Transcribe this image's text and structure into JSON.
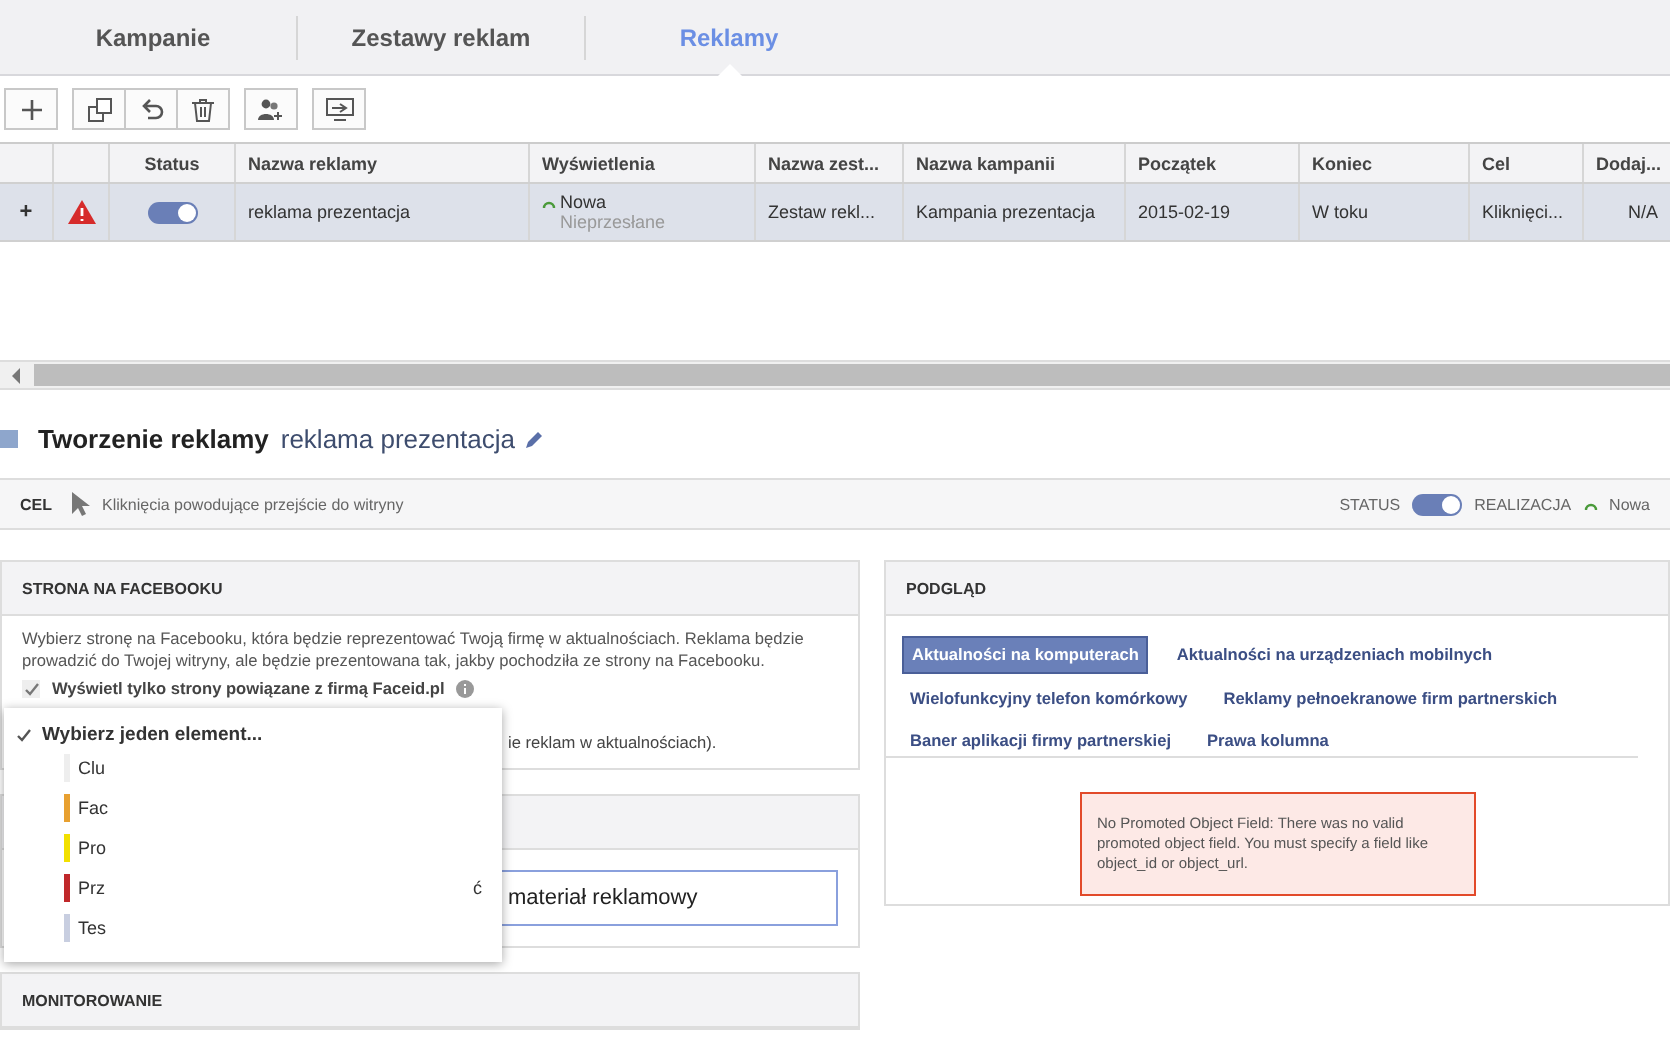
{
  "tabs": [
    {
      "label": "Kampanie",
      "selected": false
    },
    {
      "label": "Zestawy reklam",
      "selected": false
    },
    {
      "label": "Reklamy",
      "selected": true
    }
  ],
  "table": {
    "columns": [
      "Status",
      "Nazwa reklamy",
      "Wyświetlenia",
      "Nazwa zest...",
      "Nazwa kampanii",
      "Początek",
      "Koniec",
      "Cel",
      "Dodaj..."
    ],
    "rows": [
      {
        "expander": "+",
        "warning": true,
        "status_on": true,
        "name": "reklama prezentacja",
        "delivery": "Nowa",
        "delivery_note": "Nieprzesłane",
        "set": "Zestaw rekl...",
        "campaign": "Kampania prezentacja",
        "start": "2015-02-19",
        "end": "W toku",
        "goal": "Kliknięci...",
        "added": "N/A",
        "selected": true
      }
    ]
  },
  "editor": {
    "title": "Tworzenie reklamy",
    "ad_name": "reklama prezentacja"
  },
  "goal_bar": {
    "label": "CEL",
    "value": "Kliknięcia powodujące przejście do witryny",
    "status_label": "STATUS",
    "status_on": true,
    "delivery_label": "REALIZACJA",
    "delivery": "Nowa"
  },
  "facebook_page": {
    "title": "STRONA NA FACEBOOKU",
    "description": "Wybierz stronę na Facebooku, która będzie reprezentować Twoją firmę w aktualnościach. Reklama będzie prowadzić do Twojej witryny, ale będzie prezentowana tak, jakby pochodziła ze strony na Facebooku.",
    "checkbox": {
      "label": "Wyświetl tylko strony powiązane z firmą Faceid.pl",
      "checked": true
    },
    "note_fragment": "ie reklam w aktualnościach)."
  },
  "creative": {
    "input_value": "materiał reklamowy"
  },
  "dropdown": {
    "placeholder": "Wybierz jeden element...",
    "items": [
      {
        "label": "Clu",
        "color": "#eeeeee"
      },
      {
        "label": "Fac",
        "color": "#e8a030"
      },
      {
        "label": "Pro",
        "color": "#f2e000"
      },
      {
        "label": "Prz",
        "color": "#c0282a",
        "tail": "ć"
      },
      {
        "label": "Tes",
        "color": "#c8cee0"
      }
    ]
  },
  "preview": {
    "title": "PODGLĄD",
    "tabs": [
      {
        "label": "Aktualności na komputerach",
        "selected": true
      },
      {
        "label": "Aktualności na urządzeniach mobilnych",
        "selected": false
      },
      {
        "label": "Wielofunkcyjny telefon komórkowy",
        "selected": false
      },
      {
        "label": "Reklamy pełnoekranowe firm partnerskich",
        "selected": false
      },
      {
        "label": "Baner aplikacji firmy partnerskiej",
        "selected": false
      },
      {
        "label": "Prawa kolumna",
        "selected": false
      }
    ],
    "error": "No Promoted Object Field: There was no valid promoted object field. You must specify a field like object_id or object_url."
  },
  "monitoring": {
    "title": "MONITOROWANIE"
  }
}
